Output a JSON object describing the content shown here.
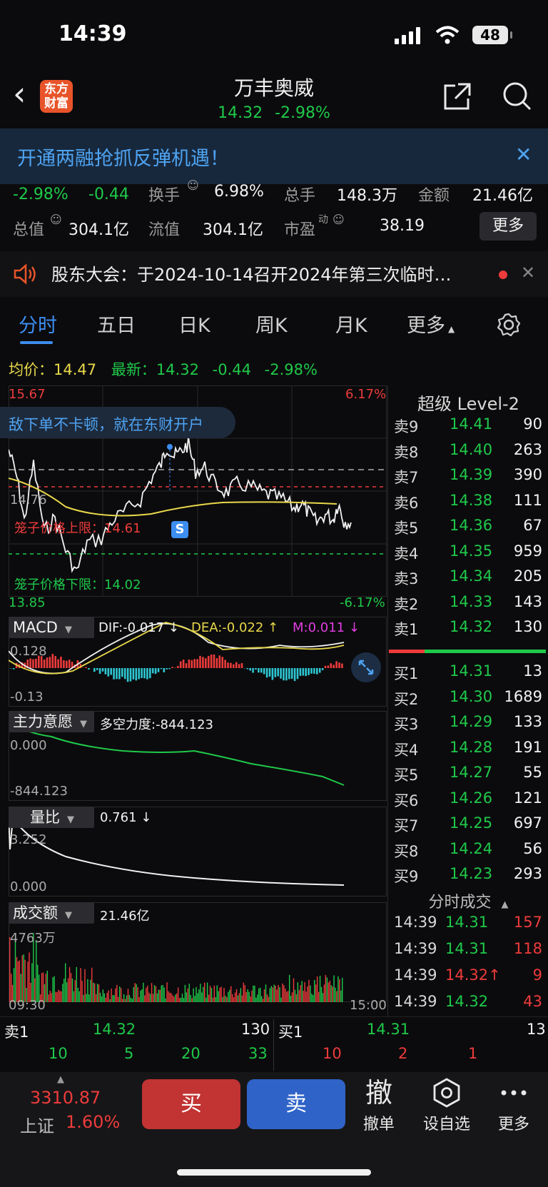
{
  "status": {
    "time": "14:39",
    "battery": "48"
  },
  "header": {
    "back": "‹",
    "logo_line1": "东方",
    "logo_line2": "财富",
    "name": "万丰奥威",
    "price": "14.32",
    "change_pct": "-2.98%"
  },
  "banner": {
    "text": "开通两融抢抓反弹机遇！",
    "close": "✕"
  },
  "stats": {
    "pct": "-2.98%",
    "chg": "-0.44",
    "turnover_label": "换手",
    "turnover": "6.98%",
    "vol_label": "总手",
    "vol": "148.3万",
    "amount_label": "金额",
    "amount": "21.46亿",
    "mcap_label": "总值",
    "mcap": "304.1亿",
    "float_label": "流值",
    "float": "304.1亿",
    "pe_label": "市盈",
    "pe_sup": "动",
    "pe": "38.19",
    "more": "更多"
  },
  "notice": {
    "text": "股东大会：于2024-10-14召开2024年第三次临时…",
    "close": "✕"
  },
  "tabs": [
    "分时",
    "五日",
    "日K",
    "周K",
    "月K",
    "更多"
  ],
  "info_line": {
    "avg_label": "均价：",
    "avg": "14.47",
    "last_label": "最新：",
    "last": "14.32",
    "chg": "-0.44",
    "pct": "-2.98%"
  },
  "chart": {
    "y_top": "15.67",
    "y_bottom": "13.85",
    "pct_top": "6.17%",
    "pct_bottom": "-6.17%",
    "ad_text": "敌下单不卡顿，就在东财开户",
    "prev_close": "14.76",
    "upper_limit_label": "笼子价格上限：14.61",
    "lower_limit_label": "笼子价格下限：14.02",
    "s_marker": "S",
    "macd_label": "MACD",
    "dif": "DIF:-0.017 ↓",
    "dea": "DEA:-0.022 ↑",
    "m": "M:0.011 ↓",
    "macd_top": "0.128",
    "macd_bottom": "-0.13",
    "force_label": "主力意愿",
    "force_value": "多空力度:-844.123",
    "force_top": "0.000",
    "force_bottom": "-844.123",
    "ratio_label": "量比",
    "ratio_value": "0.761 ↓",
    "ratio_top": "3.252",
    "ratio_bottom": "0.000",
    "amount_label": "成交额",
    "amount_value": "21.46亿",
    "amount_top": "4763万",
    "time_start": "09:30",
    "time_end": "15:00"
  },
  "orderbook": {
    "title": "超级 Level-2",
    "asks": [
      {
        "label": "卖9",
        "price": "14.41",
        "vol": "90"
      },
      {
        "label": "卖8",
        "price": "14.40",
        "vol": "263"
      },
      {
        "label": "卖7",
        "price": "14.39",
        "vol": "390"
      },
      {
        "label": "卖6",
        "price": "14.38",
        "vol": "111"
      },
      {
        "label": "卖5",
        "price": "14.36",
        "vol": "67"
      },
      {
        "label": "卖4",
        "price": "14.35",
        "vol": "959"
      },
      {
        "label": "卖3",
        "price": "14.34",
        "vol": "205"
      },
      {
        "label": "卖2",
        "price": "14.33",
        "vol": "143"
      },
      {
        "label": "卖1",
        "price": "14.32",
        "vol": "130"
      }
    ],
    "bids": [
      {
        "label": "买1",
        "price": "14.31",
        "vol": "13"
      },
      {
        "label": "买2",
        "price": "14.30",
        "vol": "1689"
      },
      {
        "label": "买3",
        "price": "14.29",
        "vol": "133"
      },
      {
        "label": "买4",
        "price": "14.28",
        "vol": "191"
      },
      {
        "label": "买5",
        "price": "14.27",
        "vol": "55"
      },
      {
        "label": "买6",
        "price": "14.26",
        "vol": "121"
      },
      {
        "label": "买7",
        "price": "14.25",
        "vol": "697"
      },
      {
        "label": "买8",
        "price": "14.24",
        "vol": "56"
      },
      {
        "label": "买9",
        "price": "14.23",
        "vol": "293"
      }
    ]
  },
  "trades": {
    "title": "分时成交",
    "rows": [
      {
        "time": "14:39",
        "price": "14.31",
        "vol": "157"
      },
      {
        "time": "14:39",
        "price": "14.31",
        "vol": "118"
      },
      {
        "time": "14:39",
        "price": "14.32↑",
        "vol": "9"
      },
      {
        "time": "14:39",
        "price": "14.32",
        "vol": "43"
      }
    ]
  },
  "strip": {
    "ask_label": "卖1",
    "ask_price": "14.32",
    "ask_vol": "130",
    "bid_label": "买1",
    "bid_price": "14.31",
    "bid_vol": "13",
    "ask_q": [
      "10",
      "5",
      "20",
      "33"
    ],
    "bid_q": [
      "10",
      "2",
      "1"
    ]
  },
  "bottom": {
    "index_value": "3310.87",
    "index_name": "上证",
    "index_pct": "1.60%",
    "buy": "买",
    "sell": "卖",
    "cancel_icon": "撤",
    "cancel_label": "撤单",
    "watch_label": "设自选",
    "more_label": "更多"
  },
  "colors": {
    "up": "#ee3b3b",
    "down": "#1fc94a",
    "avg": "#e8d84a",
    "accent": "#3d8ef0"
  }
}
